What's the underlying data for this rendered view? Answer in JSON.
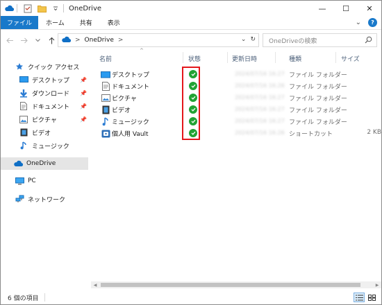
{
  "window": {
    "title": "OneDrive",
    "minimize_glyph": "—",
    "maximize_glyph": "☐",
    "close_glyph": "✕"
  },
  "ribbon": {
    "tabs": [
      "ファイル",
      "ホーム",
      "共有",
      "表示"
    ],
    "expand_glyph": "⌄",
    "help_glyph": "?"
  },
  "address": {
    "sep": ">",
    "location": "OneDrive",
    "sep2": ">",
    "dropdown_glyph": "⌄",
    "refresh_glyph": "↻"
  },
  "search": {
    "placeholder": "OneDriveの検索"
  },
  "nav": {
    "quick_access": "クイック アクセス",
    "items": [
      {
        "label": "デスクトップ",
        "icon": "desktop-icon"
      },
      {
        "label": "ダウンロード",
        "icon": "download-icon"
      },
      {
        "label": "ドキュメント",
        "icon": "document-icon"
      },
      {
        "label": "ピクチャ",
        "icon": "pictures-icon"
      },
      {
        "label": "ビデオ",
        "icon": "video-icon"
      },
      {
        "label": "ミュージック",
        "icon": "music-icon"
      }
    ],
    "onedrive": "OneDrive",
    "pc": "PC",
    "network": "ネットワーク"
  },
  "columns": {
    "name": "名前",
    "status": "状態",
    "modified": "更新日時",
    "type": "種類",
    "size": "サイズ"
  },
  "rows": [
    {
      "name": "デスクトップ",
      "icon": "desktop-folder-icon",
      "date": "2024/07/16 16:27",
      "type": "ファイル フォルダー",
      "size": ""
    },
    {
      "name": "ドキュメント",
      "icon": "document-folder-icon",
      "date": "2024/07/16 16:26",
      "type": "ファイル フォルダー",
      "size": ""
    },
    {
      "name": "ピクチャ",
      "icon": "pictures-folder-icon",
      "date": "2024/07/16 16:27",
      "type": "ファイル フォルダー",
      "size": ""
    },
    {
      "name": "ビデオ",
      "icon": "video-folder-icon",
      "date": "2024/07/16 16:27",
      "type": "ファイル フォルダー",
      "size": ""
    },
    {
      "name": "ミュージック",
      "icon": "music-folder-icon",
      "date": "2024/07/16 16:27",
      "type": "ファイル フォルダー",
      "size": ""
    },
    {
      "name": "個人用 Vault",
      "icon": "vault-shortcut-icon",
      "date": "2024/07/16 16:26",
      "type": "ショートカット",
      "size": "2 KB"
    }
  ],
  "status": {
    "count": "6 個の項目"
  },
  "colors": {
    "accent": "#1979ca",
    "ok_green": "#21a334",
    "highlight_red": "#e4161b",
    "header_text": "#4c607a"
  }
}
